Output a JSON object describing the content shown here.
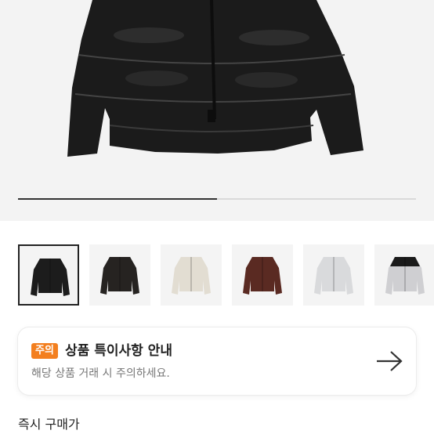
{
  "gallery": {
    "current_index": 1,
    "total_images": 2,
    "thumbnails": [
      {
        "color": "#1c1c1c",
        "accent": "#1c1c1c",
        "selected": true
      },
      {
        "color": "#262321",
        "accent": "#262321",
        "selected": false
      },
      {
        "color": "#e2ddd2",
        "accent": "#e2ddd2",
        "selected": false
      },
      {
        "color": "#5a2a22",
        "accent": "#5a2a22",
        "selected": false
      },
      {
        "color": "#d9dadc",
        "accent": "#d9dadc",
        "selected": false
      },
      {
        "color": "#cfcfd2",
        "accent": "#1a1a1a",
        "selected": false
      }
    ]
  },
  "notice": {
    "badge": "주의",
    "title": "상품 특이사항 안내",
    "subtitle": "해당 상품 거래 시 주의하세요."
  },
  "price": {
    "label": "즉시 구매가"
  },
  "colors": {
    "badge": "#f37f1f",
    "accent_text": "#222222"
  }
}
